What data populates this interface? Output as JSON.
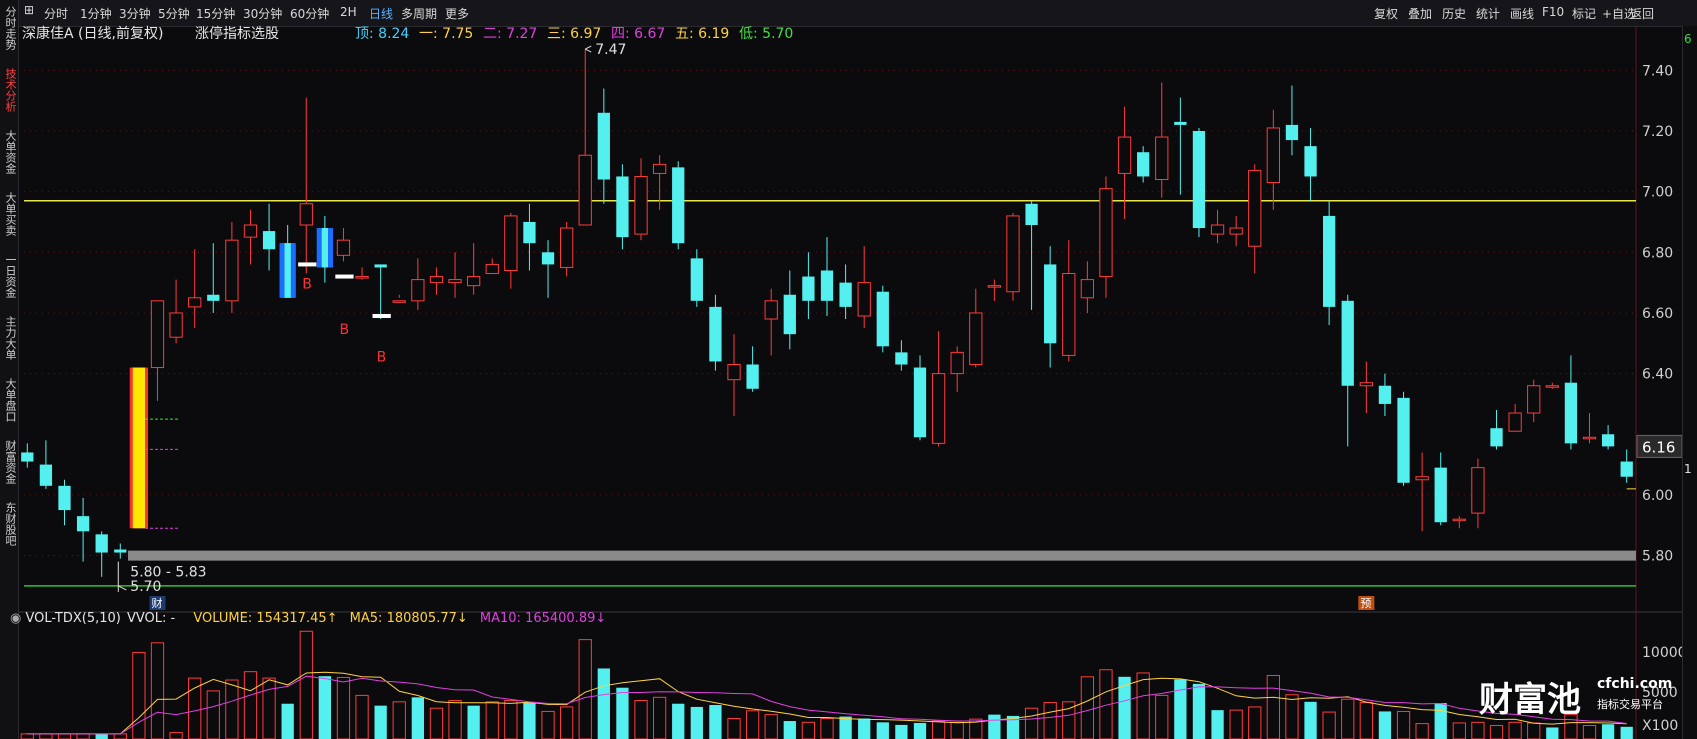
{
  "toolbar": {
    "left": [
      "分时",
      "1分钟",
      "3分钟",
      "5分钟",
      "15分钟",
      "30分钟",
      "60分钟",
      "2H",
      "日线",
      "多周期",
      "更多"
    ],
    "active": "日线",
    "right": [
      "复权",
      "叠加",
      "历史",
      "统计",
      "画线",
      "F10",
      "标记",
      "+自选",
      "返回"
    ]
  },
  "sidebar": {
    "tabs": [
      "分时走势",
      "技术分析",
      "大单资金",
      "大单买卖",
      "一日资金",
      "主力大单",
      "大单盘口",
      "财富资金",
      "东财股吧"
    ],
    "active": "技术分析"
  },
  "header": {
    "stock": "深康佳A (日线,前复权)",
    "indicator": "涨停指标选股",
    "levels": [
      {
        "label": "顶:",
        "value": "8.24",
        "color": "#3fd1ff"
      },
      {
        "label": "一:",
        "value": "7.75",
        "color": "#ffd23f"
      },
      {
        "label": "二:",
        "value": "7.27",
        "color": "#e040e0"
      },
      {
        "label": "三:",
        "value": "6.97",
        "color": "#ffd23f"
      },
      {
        "label": "四:",
        "value": "6.67",
        "color": "#e040e0"
      },
      {
        "label": "五:",
        "value": "6.19",
        "color": "#ffd23f"
      },
      {
        "label": "低:",
        "value": "5.70",
        "color": "#40e040"
      }
    ]
  },
  "annotations": {
    "high": "7.47",
    "low": "5.70",
    "range": "5.80 - 5.83",
    "current": "6.16",
    "signal_label": "B",
    "marker_cai": "财",
    "marker_yu": "预"
  },
  "volume_header": {
    "name": "VOL-TDX(5,10)",
    "vvol": "VVOL: -",
    "volume": "VOLUME: 154317.45↑",
    "ma5": "MA5: 180805.77↓",
    "ma10": "MA10: 165400.89↓",
    "axis": [
      "10000",
      "5000",
      "X100"
    ]
  },
  "watermark": {
    "brand": "财富池",
    "site": "cfchi.com",
    "sub": "指标交易平台"
  },
  "right_strip": {
    "top": "6",
    "mid": "1"
  },
  "chart_data": {
    "type": "candlestick",
    "y_ticks": [
      7.4,
      7.2,
      7.0,
      6.8,
      6.6,
      6.4,
      6.0,
      5.8
    ],
    "y_range": [
      5.67,
      7.5
    ],
    "horizontal_lines": [
      {
        "value": 6.97,
        "color": "#e6e64a"
      },
      {
        "value": 5.8,
        "color": "#8a8a8a"
      },
      {
        "value": 5.7,
        "color": "#30c030"
      }
    ],
    "candles": [
      [
        6.14,
        6.11,
        6.17,
        6.09
      ],
      [
        6.1,
        6.03,
        6.18,
        6.02
      ],
      [
        6.03,
        5.95,
        6.05,
        5.9
      ],
      [
        5.93,
        5.88,
        5.99,
        5.78
      ],
      [
        5.87,
        5.81,
        5.88,
        5.73
      ],
      [
        5.82,
        5.81,
        5.84,
        5.79
      ],
      [
        5.89,
        6.42,
        6.05,
        5.82
      ],
      [
        6.42,
        6.64,
        6.56,
        6.31
      ],
      [
        6.52,
        6.6,
        6.71,
        6.5
      ],
      [
        6.62,
        6.65,
        6.81,
        6.55
      ],
      [
        6.66,
        6.64,
        6.83,
        6.6
      ],
      [
        6.64,
        6.84,
        6.9,
        6.6
      ],
      [
        6.85,
        6.89,
        6.94,
        6.76
      ],
      [
        6.87,
        6.81,
        6.96,
        6.74
      ],
      [
        6.83,
        6.65,
        6.89,
        6.66
      ],
      [
        6.89,
        6.96,
        7.31,
        6.73
      ],
      [
        6.85,
        6.75,
        6.92,
        6.7
      ],
      [
        6.79,
        6.84,
        6.88,
        6.77
      ],
      [
        6.72,
        6.72,
        6.75,
        6.71
      ],
      [
        6.76,
        6.75,
        6.76,
        6.58
      ],
      [
        6.64,
        6.64,
        6.66,
        6.65
      ],
      [
        6.64,
        6.71,
        6.78,
        6.61
      ],
      [
        6.7,
        6.72,
        6.75,
        6.66
      ],
      [
        6.7,
        6.71,
        6.8,
        6.65
      ],
      [
        6.69,
        6.72,
        6.83,
        6.66
      ],
      [
        6.73,
        6.76,
        6.78,
        6.74
      ],
      [
        6.74,
        6.92,
        6.93,
        6.68
      ],
      [
        6.9,
        6.83,
        6.96,
        6.74
      ],
      [
        6.8,
        6.76,
        6.84,
        6.65
      ],
      [
        6.75,
        6.88,
        6.9,
        6.72
      ],
      [
        6.89,
        7.12,
        7.47,
        6.9
      ],
      [
        7.26,
        7.04,
        7.34,
        6.96
      ],
      [
        7.05,
        6.85,
        7.09,
        6.81
      ],
      [
        6.86,
        7.05,
        7.11,
        6.84
      ],
      [
        7.06,
        7.09,
        7.12,
        6.94
      ],
      [
        7.08,
        6.83,
        7.1,
        6.81
      ],
      [
        6.78,
        6.64,
        6.81,
        6.62
      ],
      [
        6.62,
        6.44,
        6.66,
        6.41
      ],
      [
        6.38,
        6.43,
        6.53,
        6.26
      ],
      [
        6.43,
        6.35,
        6.49,
        6.34
      ],
      [
        6.58,
        6.64,
        6.68,
        6.46
      ],
      [
        6.66,
        6.53,
        6.74,
        6.48
      ],
      [
        6.72,
        6.64,
        6.8,
        6.58
      ],
      [
        6.74,
        6.64,
        6.85,
        6.59
      ],
      [
        6.7,
        6.62,
        6.76,
        6.58
      ],
      [
        6.59,
        6.7,
        6.82,
        6.55
      ],
      [
        6.67,
        6.49,
        6.69,
        6.47
      ],
      [
        6.47,
        6.43,
        6.51,
        6.41
      ],
      [
        6.42,
        6.19,
        6.46,
        6.18
      ],
      [
        6.17,
        6.4,
        6.54,
        6.16
      ],
      [
        6.4,
        6.47,
        6.49,
        6.34
      ],
      [
        6.43,
        6.6,
        6.68,
        6.42
      ],
      [
        6.69,
        6.69,
        6.71,
        6.64
      ],
      [
        6.67,
        6.92,
        6.93,
        6.64
      ],
      [
        6.96,
        6.89,
        6.97,
        6.61
      ],
      [
        6.76,
        6.5,
        6.82,
        6.42
      ],
      [
        6.46,
        6.73,
        6.84,
        6.44
      ],
      [
        6.65,
        6.71,
        6.77,
        6.6
      ],
      [
        6.72,
        7.01,
        7.05,
        6.65
      ],
      [
        7.06,
        7.18,
        7.28,
        6.91
      ],
      [
        7.13,
        7.05,
        7.15,
        7.03
      ],
      [
        7.04,
        7.18,
        7.36,
        6.98
      ],
      [
        7.23,
        7.22,
        7.31,
        6.99
      ],
      [
        7.2,
        6.88,
        7.21,
        6.85
      ],
      [
        6.86,
        6.89,
        6.94,
        6.83
      ],
      [
        6.86,
        6.88,
        6.92,
        6.82
      ],
      [
        6.82,
        7.07,
        7.09,
        6.73
      ],
      [
        7.03,
        7.21,
        7.27,
        6.94
      ],
      [
        7.22,
        7.17,
        7.35,
        7.12
      ],
      [
        7.15,
        7.05,
        7.21,
        6.97
      ],
      [
        6.92,
        6.62,
        6.97,
        6.56
      ],
      [
        6.64,
        6.36,
        6.66,
        6.16
      ],
      [
        6.36,
        6.37,
        6.44,
        6.27
      ],
      [
        6.36,
        6.3,
        6.4,
        6.26
      ],
      [
        6.32,
        6.04,
        6.34,
        6.03
      ],
      [
        6.05,
        6.06,
        6.14,
        5.88
      ],
      [
        6.09,
        5.91,
        6.14,
        5.9
      ],
      [
        5.92,
        5.92,
        5.93,
        5.89
      ],
      [
        5.94,
        6.09,
        6.12,
        5.89
      ],
      [
        6.22,
        6.16,
        6.28,
        6.15
      ],
      [
        6.21,
        6.27,
        6.3,
        6.21
      ],
      [
        6.27,
        6.36,
        6.38,
        6.24
      ],
      [
        6.36,
        6.36,
        6.37,
        6.35
      ],
      [
        6.37,
        6.17,
        6.46,
        6.15
      ],
      [
        6.19,
        6.19,
        6.27,
        6.17
      ],
      [
        6.2,
        6.16,
        6.23,
        6.15
      ],
      [
        6.11,
        6.06,
        6.15,
        6.04
      ]
    ],
    "volume": [
      [
        8,
        1
      ],
      [
        8,
        1
      ],
      [
        8,
        1
      ],
      [
        8,
        1
      ],
      [
        8,
        0
      ],
      [
        8,
        1
      ],
      [
        135,
        1
      ],
      [
        150,
        1
      ],
      [
        10,
        1
      ],
      [
        95,
        1
      ],
      [
        75,
        1
      ],
      [
        92,
        1
      ],
      [
        105,
        1
      ],
      [
        95,
        1
      ],
      [
        55,
        0
      ],
      [
        168,
        1
      ],
      [
        98,
        0
      ],
      [
        96,
        1
      ],
      [
        68,
        1
      ],
      [
        52,
        0
      ],
      [
        58,
        1
      ],
      [
        65,
        0
      ],
      [
        48,
        1
      ],
      [
        60,
        1
      ],
      [
        52,
        0
      ],
      [
        58,
        1
      ],
      [
        60,
        1
      ],
      [
        57,
        0
      ],
      [
        43,
        1
      ],
      [
        50,
        1
      ],
      [
        155,
        1
      ],
      [
        110,
        0
      ],
      [
        80,
        0
      ],
      [
        60,
        1
      ],
      [
        65,
        1
      ],
      [
        55,
        0
      ],
      [
        50,
        0
      ],
      [
        53,
        0
      ],
      [
        32,
        1
      ],
      [
        44,
        1
      ],
      [
        38,
        1
      ],
      [
        28,
        0
      ],
      [
        26,
        1
      ],
      [
        32,
        1
      ],
      [
        35,
        0
      ],
      [
        32,
        0
      ],
      [
        26,
        0
      ],
      [
        22,
        0
      ],
      [
        25,
        0
      ],
      [
        28,
        1
      ],
      [
        26,
        1
      ],
      [
        31,
        1
      ],
      [
        38,
        0
      ],
      [
        36,
        0
      ],
      [
        48,
        1
      ],
      [
        57,
        1
      ],
      [
        58,
        1
      ],
      [
        97,
        1
      ],
      [
        108,
        1
      ],
      [
        97,
        0
      ],
      [
        103,
        1
      ],
      [
        68,
        1
      ],
      [
        93,
        0
      ],
      [
        86,
        0
      ],
      [
        45,
        0
      ],
      [
        45,
        1
      ],
      [
        50,
        1
      ],
      [
        99,
        1
      ],
      [
        69,
        1
      ],
      [
        58,
        0
      ],
      [
        42,
        1
      ],
      [
        62,
        1
      ],
      [
        57,
        1
      ],
      [
        43,
        0
      ],
      [
        43,
        1
      ],
      [
        24,
        1
      ],
      [
        56,
        0
      ],
      [
        25,
        1
      ],
      [
        26,
        1
      ],
      [
        21,
        1
      ],
      [
        26,
        1
      ],
      [
        25,
        1
      ],
      [
        18,
        0
      ],
      [
        38,
        1
      ],
      [
        21,
        1
      ],
      [
        23,
        0
      ],
      [
        19,
        0
      ]
    ]
  }
}
